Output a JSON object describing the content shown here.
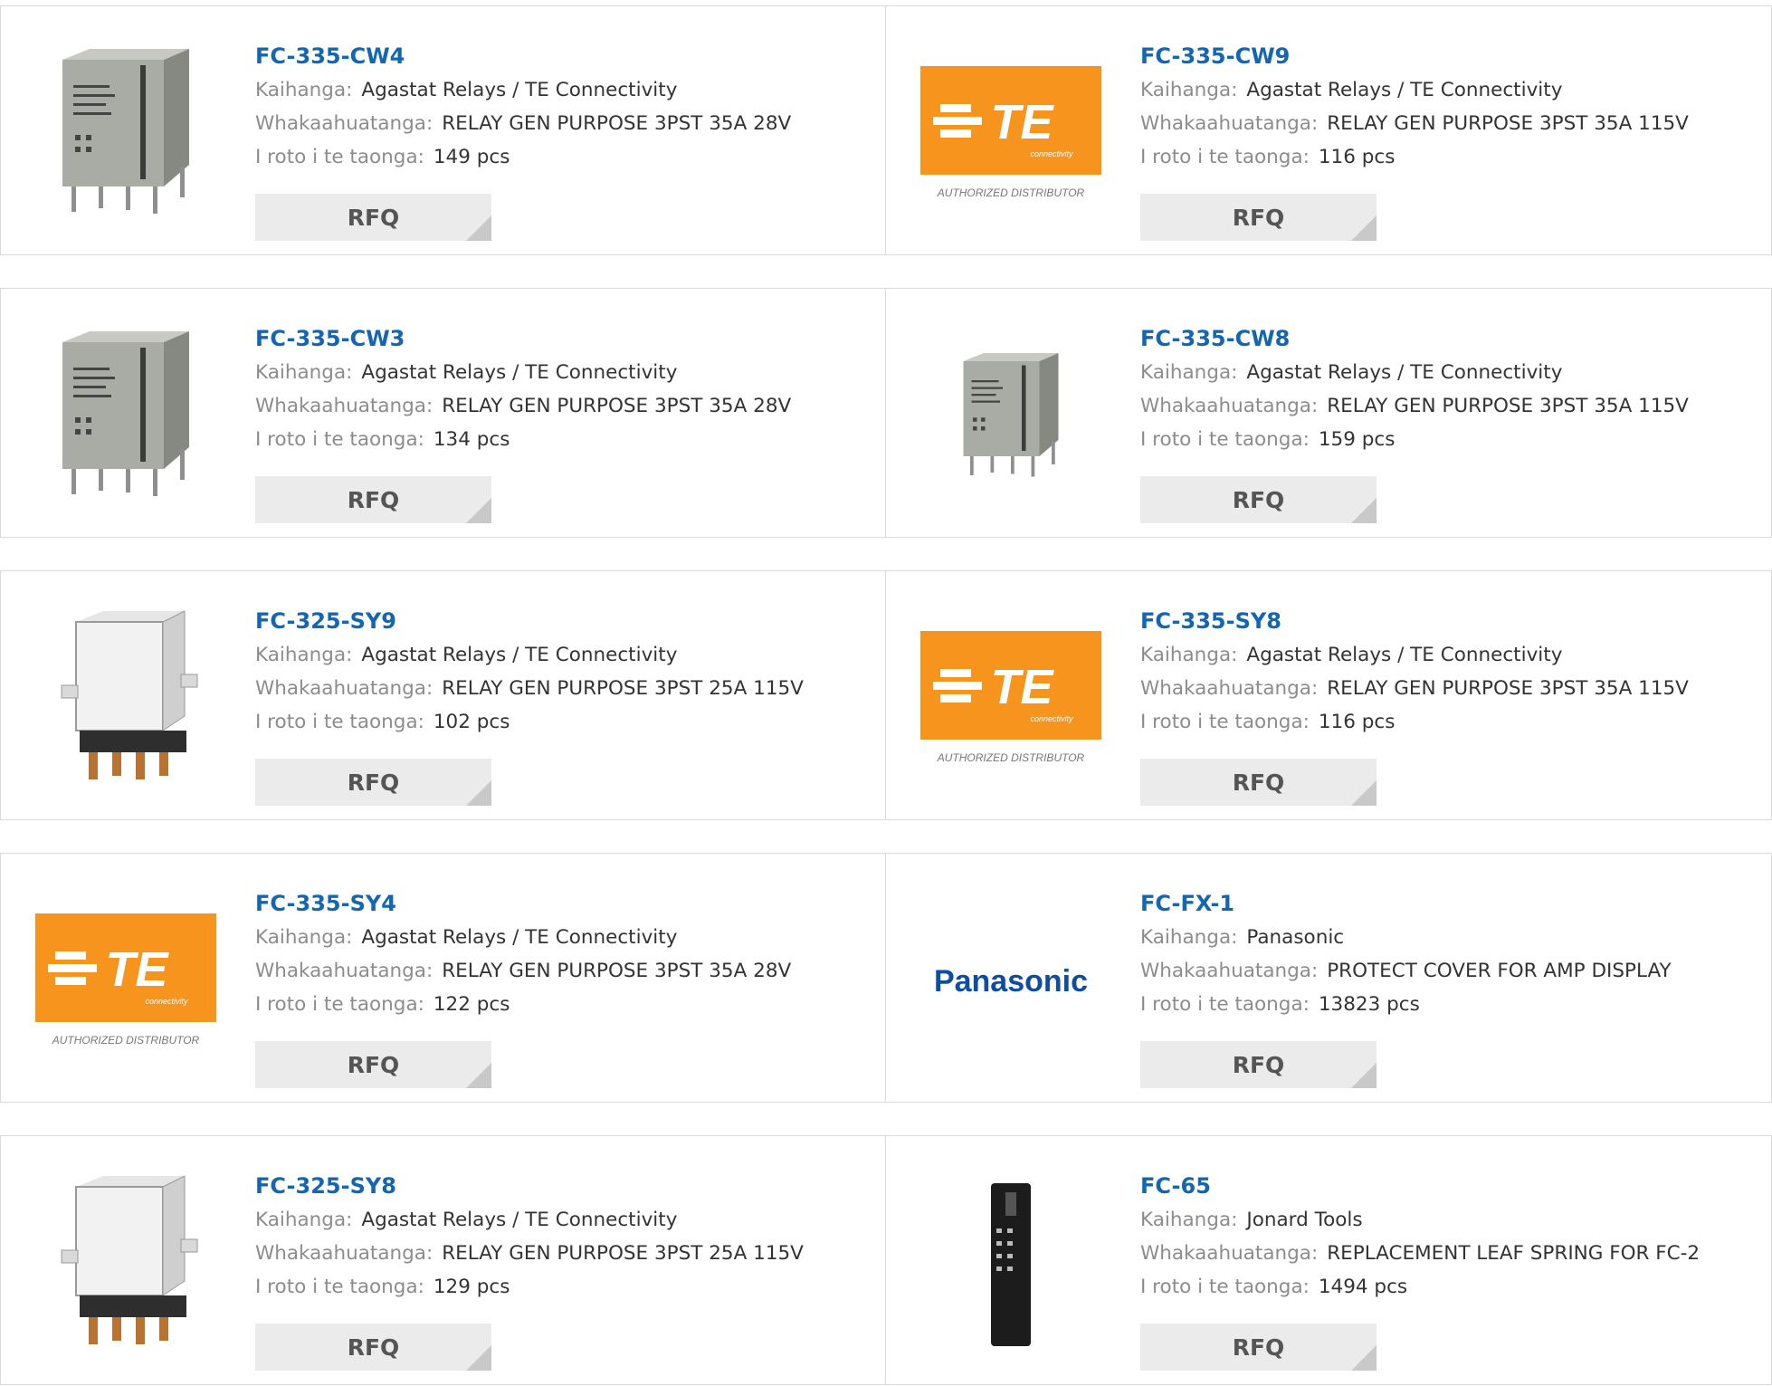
{
  "labels": {
    "manufacturer": "Kaihanga:",
    "description": "Whakaahuatanga:",
    "stock": "I roto i te taonga:",
    "rfq": "RFQ"
  },
  "logo_text": {
    "te_mark": "TE",
    "te_sub": "connectivity",
    "te_badge": "AUTHORIZED DISTRIBUTOR",
    "panasonic": "Panasonic"
  },
  "colors": {
    "link": "#1266b4",
    "te_orange": "#f7941d",
    "panasonic_blue": "#0d4ea2"
  },
  "products": [
    {
      "part": "FC-335-CW4",
      "manufacturer": "Agastat Relays / TE Connectivity",
      "description": "RELAY GEN PURPOSE 3PST 35A 28V",
      "stock": "149 pcs",
      "image": "relay-gray-icon"
    },
    {
      "part": "FC-335-CW9",
      "manufacturer": "Agastat Relays / TE Connectivity",
      "description": "RELAY GEN PURPOSE 3PST 35A 115V",
      "stock": "116 pcs",
      "image": "te-logo"
    },
    {
      "part": "FC-335-CW3",
      "manufacturer": "Agastat Relays / TE Connectivity",
      "description": "RELAY GEN PURPOSE 3PST 35A 28V",
      "stock": "134 pcs",
      "image": "relay-gray-icon"
    },
    {
      "part": "FC-335-CW8",
      "manufacturer": "Agastat Relays / TE Connectivity",
      "description": "RELAY GEN PURPOSE 3PST 35A 115V",
      "stock": "159 pcs",
      "image": "relay-gray-small-icon"
    },
    {
      "part": "FC-325-SY9",
      "manufacturer": "Agastat Relays / TE Connectivity",
      "description": "RELAY GEN PURPOSE 3PST 25A 115V",
      "stock": "102 pcs",
      "image": "relay-chrome-icon"
    },
    {
      "part": "FC-335-SY8",
      "manufacturer": "Agastat Relays / TE Connectivity",
      "description": "RELAY GEN PURPOSE 3PST 35A 115V",
      "stock": "116 pcs",
      "image": "te-logo"
    },
    {
      "part": "FC-335-SY4",
      "manufacturer": "Agastat Relays / TE Connectivity",
      "description": "RELAY GEN PURPOSE 3PST 35A 28V",
      "stock": "122 pcs",
      "image": "te-logo"
    },
    {
      "part": "FC-FX-1",
      "manufacturer": "Panasonic",
      "description": "PROTECT COVER FOR AMP DISPLAY",
      "stock": "13823 pcs",
      "image": "panasonic-logo"
    },
    {
      "part": "FC-325-SY8",
      "manufacturer": "Agastat Relays / TE Connectivity",
      "description": "RELAY GEN PURPOSE 3PST 25A 115V",
      "stock": "129 pcs",
      "image": "relay-chrome-icon"
    },
    {
      "part": "FC-65",
      "manufacturer": "Jonard Tools",
      "description": "REPLACEMENT LEAF SPRING FOR FC-2",
      "stock": "1494 pcs",
      "image": "leaf-spring-icon"
    }
  ]
}
